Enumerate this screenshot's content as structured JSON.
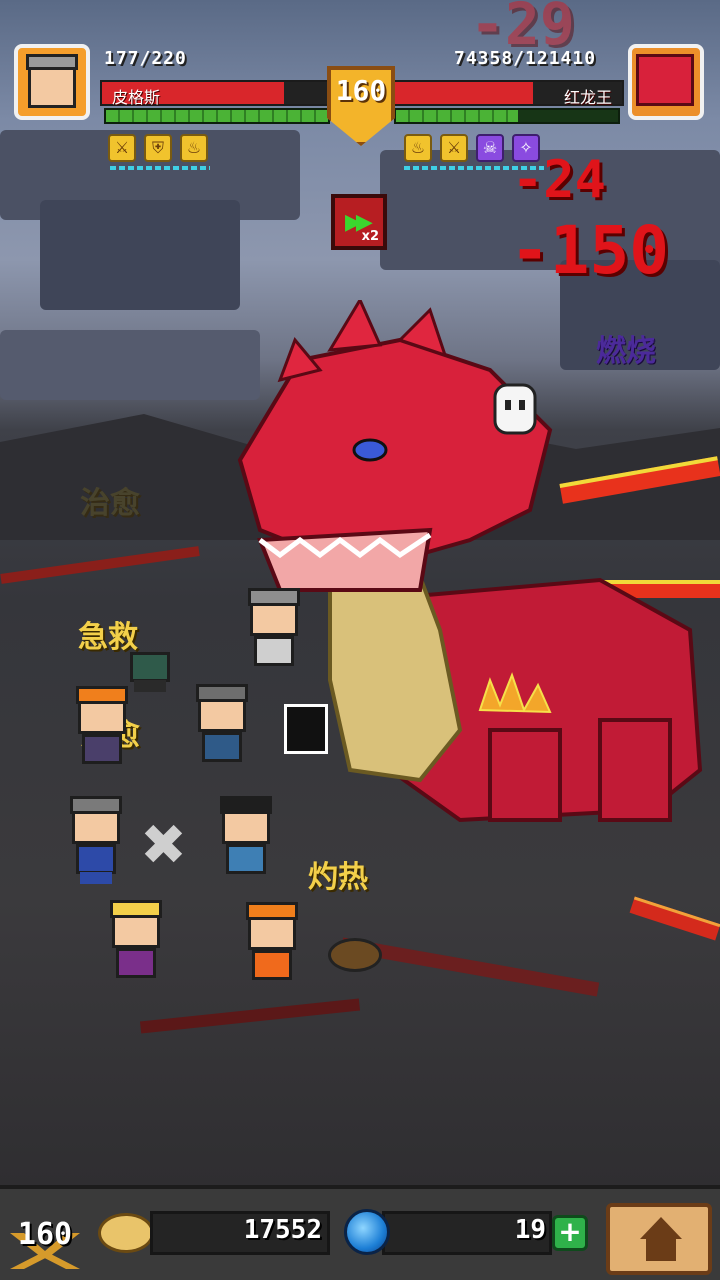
{
  "hud": {
    "player_hp": "177/220",
    "player_name": "皮格斯",
    "player_hp_fraction": 0.8,
    "boss_hp": "74358/121410",
    "boss_name": "红龙王",
    "boss_hp_fraction": 0.61,
    "level": "160",
    "speed_label": "x2",
    "player_buffs": [
      "buff-sword-icon",
      "buff-shield-icon",
      "buff-fire-icon"
    ],
    "boss_buffs": [
      "debuff-fire-icon",
      "debuff-sword-icon",
      "debuff-curse-icon",
      "debuff-magic-icon"
    ]
  },
  "floating_text": {
    "damage_1": "-29",
    "damage_2": "-24",
    "damage_3": "-150",
    "status_burn": "燃烧",
    "heal_faded": "治愈",
    "first_aid": "急救",
    "heal": "治愈",
    "scorch": "灼热"
  },
  "bottom": {
    "level": "160",
    "gold": "17552",
    "gems": "19",
    "add_label": "+"
  },
  "colors": {
    "hp_red": "#d9262b",
    "energy_green": "#4bb336",
    "dragon_red": "#d8213b",
    "text_yellow": "#f3d04a"
  }
}
